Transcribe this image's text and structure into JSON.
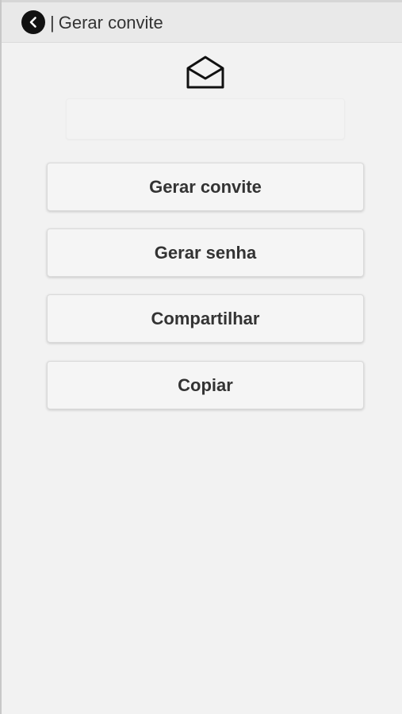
{
  "header": {
    "separator": "|",
    "title": "Gerar convite",
    "back_icon": "chevron-left-icon"
  },
  "invite": {
    "icon": "envelope-open-icon",
    "code_value": ""
  },
  "actions": [
    {
      "label": "Gerar convite"
    },
    {
      "label": "Gerar senha"
    },
    {
      "label": "Compartilhar"
    },
    {
      "label": "Copiar"
    }
  ],
  "colors": {
    "background": "#f2f2f2",
    "header": "#e9e9e9",
    "text": "#333333",
    "back_button": "#111111"
  }
}
